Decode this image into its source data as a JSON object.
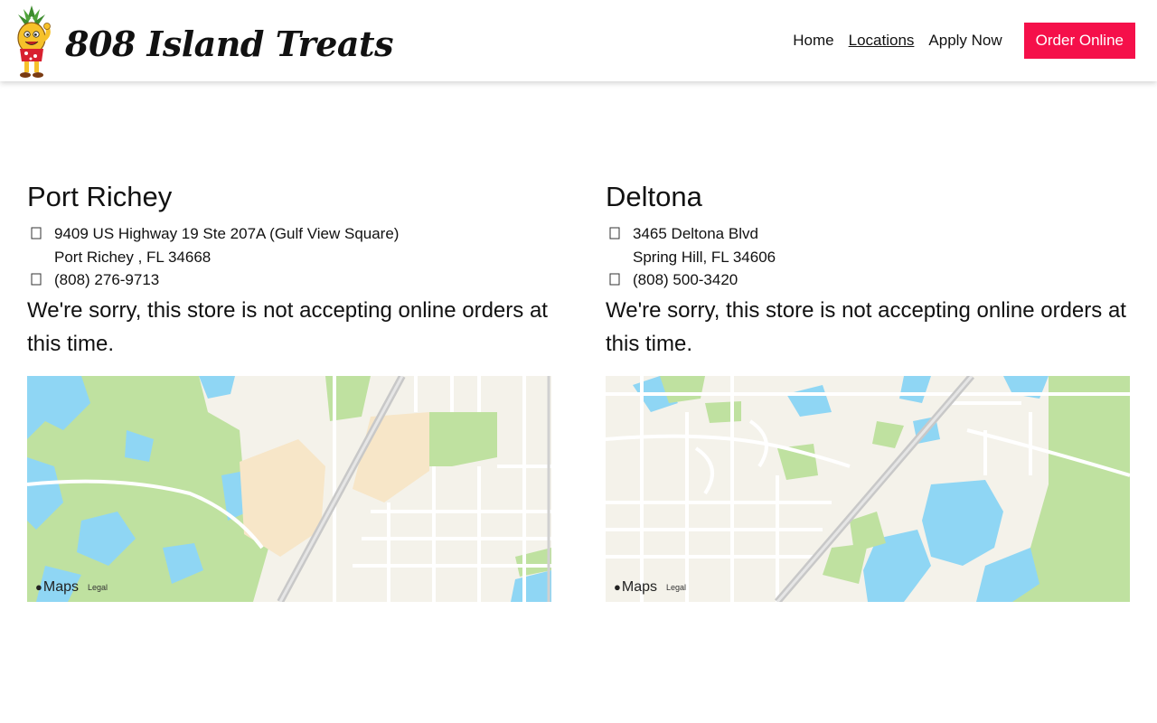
{
  "brand": {
    "name": "808 Island Treats",
    "logo_icon": "pineapple-mascot-icon"
  },
  "nav": {
    "items": [
      {
        "label": "Home"
      },
      {
        "label": "Locations"
      },
      {
        "label": "Apply Now"
      }
    ],
    "order_label": "Order Online",
    "order_color": "#f5104a"
  },
  "locations": [
    {
      "name": "Port Richey",
      "address_line1": "9409 US Highway 19 Ste 207A (Gulf View Square)",
      "address_line2": "Port Richey , FL 34668",
      "phone": "(808) 276-9713",
      "notice": "We're sorry, this store is not accepting online orders at this time.",
      "map_badge": "Maps",
      "map_legal": "Legal"
    },
    {
      "name": "Deltona",
      "address_line1": "3465 Deltona Blvd",
      "address_line2": "Spring Hill, FL 34606",
      "phone": "(808) 500-3420",
      "notice": "We're sorry, this store is not accepting online orders at this time.",
      "map_badge": "Maps",
      "map_legal": "Legal"
    }
  ],
  "colors": {
    "water": "#8fd6f4",
    "park": "#bfe1a0",
    "land": "#f4f2ea",
    "road": "#ffffff",
    "highway": "#c8c8c8",
    "sand": "#f7e6c8"
  }
}
